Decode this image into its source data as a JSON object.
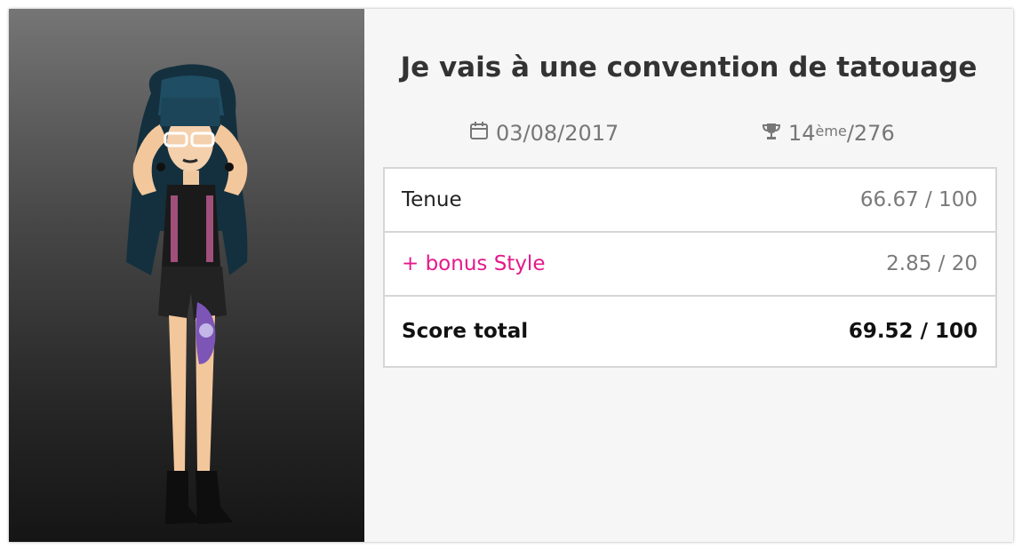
{
  "avatar": {
    "description_icon": "avatar-icon"
  },
  "event": {
    "title": "Je vais à une convention de tatouage",
    "date": "03/08/2017",
    "rank": "14",
    "rank_suffix": "ème",
    "rank_total": "/276"
  },
  "scores": {
    "tenue_label": "Tenue",
    "tenue_value": "66.67 / 100",
    "bonus_label": "+ bonus Style",
    "bonus_value": "2.85 / 20",
    "total_label": "Score total",
    "total_value": "69.52 / 100"
  },
  "icons": {
    "date": "calendar-icon",
    "rank": "trophy-icon"
  },
  "colors": {
    "bonus": "#e5198a",
    "panel_top": "#757575",
    "panel_bottom": "#151515"
  }
}
